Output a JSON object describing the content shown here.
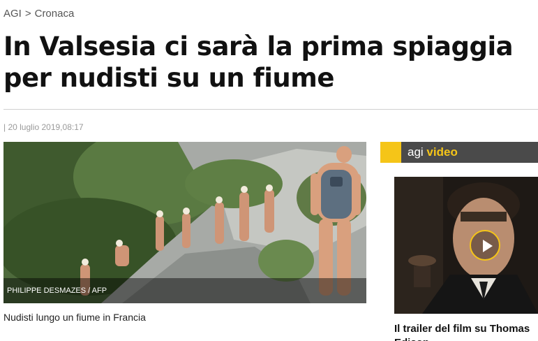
{
  "breadcrumb": {
    "home": "AGI",
    "separator": ">",
    "section": "Cronaca"
  },
  "article": {
    "headline": "In Valsesia ci sarà la prima spiaggia per nudisti su un fiume",
    "dateline": "| 20 luglio 2019,08:17",
    "photo_credit": "PHILIPPE DESMAZES / AFP",
    "caption": "Nudisti lungo un fiume in Francia"
  },
  "video": {
    "brand": "agi",
    "label": "video",
    "title": "Il trailer del film su Thomas Edison",
    "accent_color": "#f5c518",
    "play_icon": "play-icon"
  }
}
